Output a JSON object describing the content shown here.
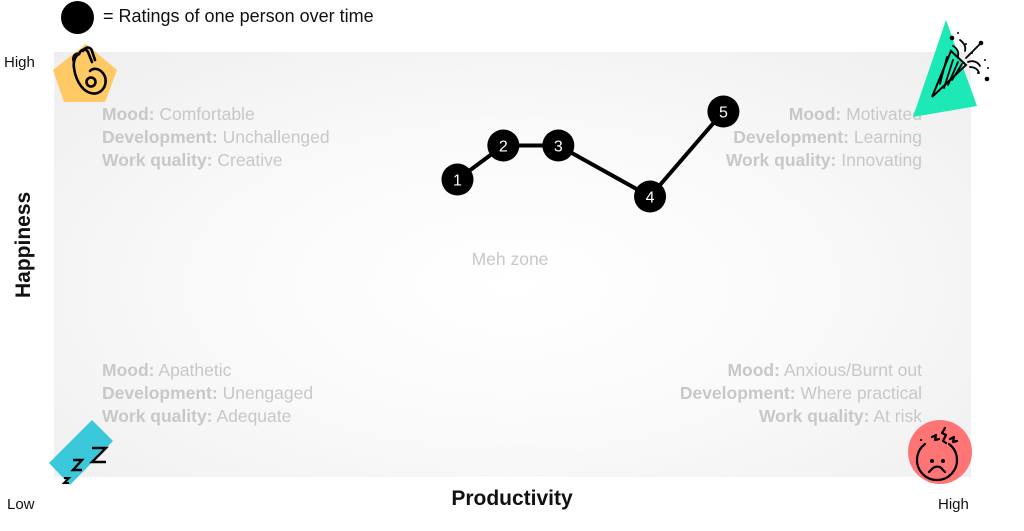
{
  "legend": {
    "marker": "filled-black-circle",
    "text": "= Ratings of one person over time"
  },
  "axes": {
    "y_title": "Happiness",
    "x_title": "Productivity",
    "y_high": "High",
    "x_low": "Low",
    "x_high": "High"
  },
  "quadrants": {
    "top_left": {
      "icon": "ok-hand-icon",
      "icon_color": "#FFC966",
      "lines": [
        {
          "key": "Mood:",
          "value": "Comfortable"
        },
        {
          "key": "Development:",
          "value": "Unchallenged"
        },
        {
          "key": "Work quality:",
          "value": "Creative"
        }
      ]
    },
    "top_right": {
      "icon": "party-popper-icon",
      "icon_color": "#1DE9B6",
      "lines": [
        {
          "key": "Mood:",
          "value": "Motivated"
        },
        {
          "key": "Development:",
          "value": "Learning"
        },
        {
          "key": "Work quality:",
          "value": "Innovating"
        }
      ]
    },
    "bottom_left": {
      "icon": "sleeping-zzz-icon",
      "icon_color": "#3BC8DB",
      "lines": [
        {
          "key": "Mood:",
          "value": "Apathetic"
        },
        {
          "key": "Development:",
          "value": "Unengaged"
        },
        {
          "key": "Work quality:",
          "value": "Adequate"
        }
      ]
    },
    "bottom_right": {
      "icon": "stressed-face-icon",
      "icon_color": "#FF7474",
      "lines": [
        {
          "key": "Mood:",
          "value": "Anxious/Burnt out"
        },
        {
          "key": "Development:",
          "value": "Where practical"
        },
        {
          "key": "Work quality:",
          "value": "At risk"
        }
      ]
    }
  },
  "center_label": "Meh zone",
  "colors": {
    "path": "#000000",
    "marker": "#000000",
    "quadrant_text": "#C8C8C8"
  },
  "chart_data": {
    "type": "line",
    "title": "",
    "xlabel": "Productivity",
    "ylabel": "Happiness",
    "xlim": [
      0,
      10
    ],
    "ylim": [
      0,
      10
    ],
    "x_tick_labels": [
      "Low",
      "High"
    ],
    "y_tick_labels": [
      "High"
    ],
    "grid": false,
    "legend": "top-left",
    "series": [
      {
        "name": "Ratings of one person over time",
        "points": [
          {
            "label": "1",
            "x": 4.4,
            "y": 7.0
          },
          {
            "label": "2",
            "x": 4.9,
            "y": 7.8
          },
          {
            "label": "3",
            "x": 5.5,
            "y": 7.8
          },
          {
            "label": "4",
            "x": 6.5,
            "y": 6.6
          },
          {
            "label": "5",
            "x": 7.3,
            "y": 8.6
          }
        ]
      }
    ],
    "annotations": [
      "Meh zone"
    ]
  }
}
